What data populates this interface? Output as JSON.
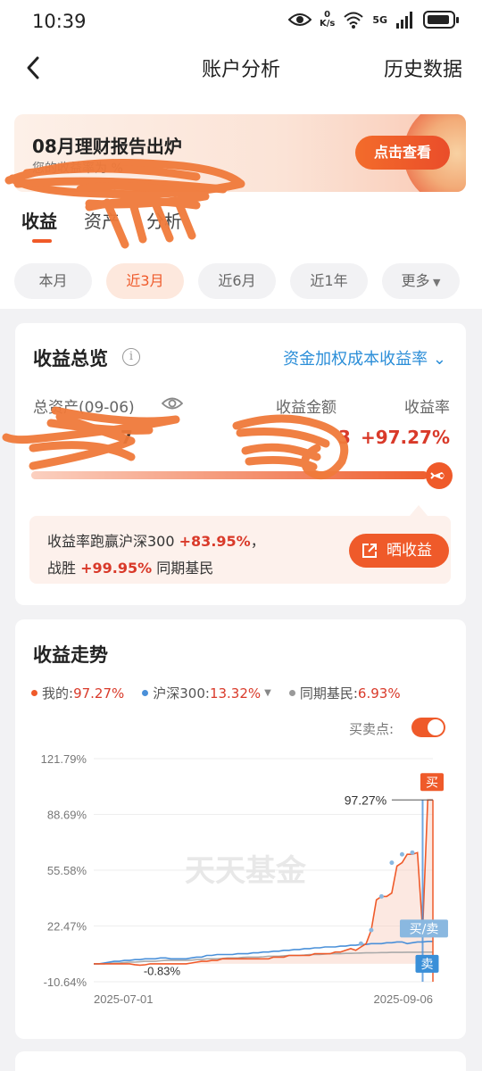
{
  "status_bar": {
    "time": "10:39",
    "netspeed_value": "0",
    "netspeed_unit": "K/s",
    "network": "5G"
  },
  "nav": {
    "title": "账户分析",
    "right_label": "历史数据"
  },
  "banner": {
    "title": "08月理财报告出炉",
    "subtitle": "您的收益率为 %",
    "button_label": "点击查看"
  },
  "tabs": [
    {
      "label": "收益",
      "active": true
    },
    {
      "label": "资产",
      "active": false
    },
    {
      "label": "分析",
      "active": false
    }
  ],
  "periods": [
    {
      "label": "本月",
      "active": false
    },
    {
      "label": "近3月",
      "active": true
    },
    {
      "label": "近6月",
      "active": false
    },
    {
      "label": "近1年",
      "active": false
    },
    {
      "label": "更多",
      "active": false
    }
  ],
  "overview": {
    "title": "收益总览",
    "metric_select": "资金加权成本收益率",
    "total_assets_label": "总资产(09-06)",
    "total_assets_value": "7",
    "profit_label": "收益金额",
    "profit_value": "3",
    "rate_label": "收益率",
    "rate_value": "+97.27%",
    "progress_fraction": 0.97,
    "compare_line1_prefix": "收益率跑赢沪深300 ",
    "compare_line1_value": "+83.95%",
    "compare_line1_suffix": "，",
    "compare_line2_prefix": "战胜 ",
    "compare_line2_value": "+99.95%",
    "compare_line2_suffix": " 同期基民",
    "share_label": "晒收益"
  },
  "trend": {
    "title": "收益走势",
    "legend": [
      {
        "name": "我的:",
        "value": "97.27%",
        "color": "#ef5a2a",
        "has_dropdown": false
      },
      {
        "name": "沪深300:",
        "value": "13.32%",
        "color": "#4a90d9",
        "has_dropdown": true
      },
      {
        "name": "同期基民:",
        "value": "6.93%",
        "color": "#999999",
        "has_dropdown": false
      }
    ],
    "buy_sell_label": "买卖点:",
    "buy_sell_on": true,
    "watermark": "天天基金"
  },
  "chart_data": {
    "type": "line",
    "y_ticks": [
      "121.79%",
      "88.69%",
      "55.58%",
      "22.47%",
      "-10.64%"
    ],
    "ylim": [
      -10.64,
      121.79
    ],
    "x_ticks": [
      "2025-07-01",
      "2025-09-06"
    ],
    "annotations": {
      "max_label": "97.27%",
      "min_label": "-0.83%",
      "buy_marker": "买",
      "buy_sell_marker": "买/卖",
      "sell_marker": "卖"
    },
    "series": [
      {
        "name": "我的",
        "color": "#ef5a2a",
        "values": [
          0,
          0,
          0,
          0,
          0,
          0,
          0,
          0,
          -0.5,
          -0.83,
          -0.6,
          0,
          0,
          0,
          0,
          0,
          0,
          0,
          0,
          0.5,
          1,
          1.5,
          1.5,
          2,
          2,
          3,
          3,
          3,
          3,
          3,
          3,
          3,
          3,
          3,
          3,
          4,
          4,
          4,
          5,
          5,
          5,
          5,
          5,
          6,
          6,
          6,
          6,
          7,
          7,
          8,
          9,
          8,
          10,
          12,
          20,
          38,
          40,
          40,
          42,
          58,
          60,
          65,
          65,
          66,
          20,
          97.27,
          97.27
        ]
      },
      {
        "name": "沪深300",
        "color": "#4a90d9",
        "values": [
          0,
          0,
          0.5,
          1,
          1.5,
          1.5,
          2,
          2,
          2.5,
          2.5,
          3,
          3,
          3,
          3.5,
          3.5,
          3,
          3,
          3,
          3,
          3.5,
          4,
          4,
          5,
          5,
          5.5,
          5.5,
          5.5,
          5.5,
          6,
          6,
          6,
          6.5,
          6.5,
          7,
          7,
          7.5,
          7.5,
          8,
          8,
          8.5,
          8.5,
          9,
          9,
          9.5,
          9.5,
          10,
          10,
          10,
          10.5,
          10.5,
          11,
          11,
          11.5,
          11.5,
          12,
          12,
          12,
          12.5,
          12.5,
          13,
          13,
          12,
          12.5,
          13,
          13,
          13.32,
          13.32
        ]
      },
      {
        "name": "同期基民",
        "color": "#aaaaaa",
        "values": [
          0,
          0,
          0,
          0.3,
          0.5,
          0.5,
          0.8,
          1,
          1,
          1.2,
          1.5,
          1.5,
          1.5,
          1.8,
          2,
          2,
          2,
          2,
          2,
          2.2,
          2.5,
          2.5,
          3,
          3,
          3,
          3.2,
          3.5,
          3.5,
          3.5,
          3.8,
          4,
          4,
          4,
          4.2,
          4.5,
          4.5,
          4.5,
          4.8,
          5,
          5,
          5,
          5.2,
          5.5,
          5.5,
          5.5,
          5.8,
          6,
          6,
          6,
          6.2,
          6.2,
          6.3,
          6.4,
          6.5,
          6.5,
          6.6,
          6.7,
          6.7,
          6.8,
          6.8,
          6.8,
          6.9,
          6.9,
          6.9,
          6.93,
          6.93,
          6.93
        ]
      }
    ]
  }
}
